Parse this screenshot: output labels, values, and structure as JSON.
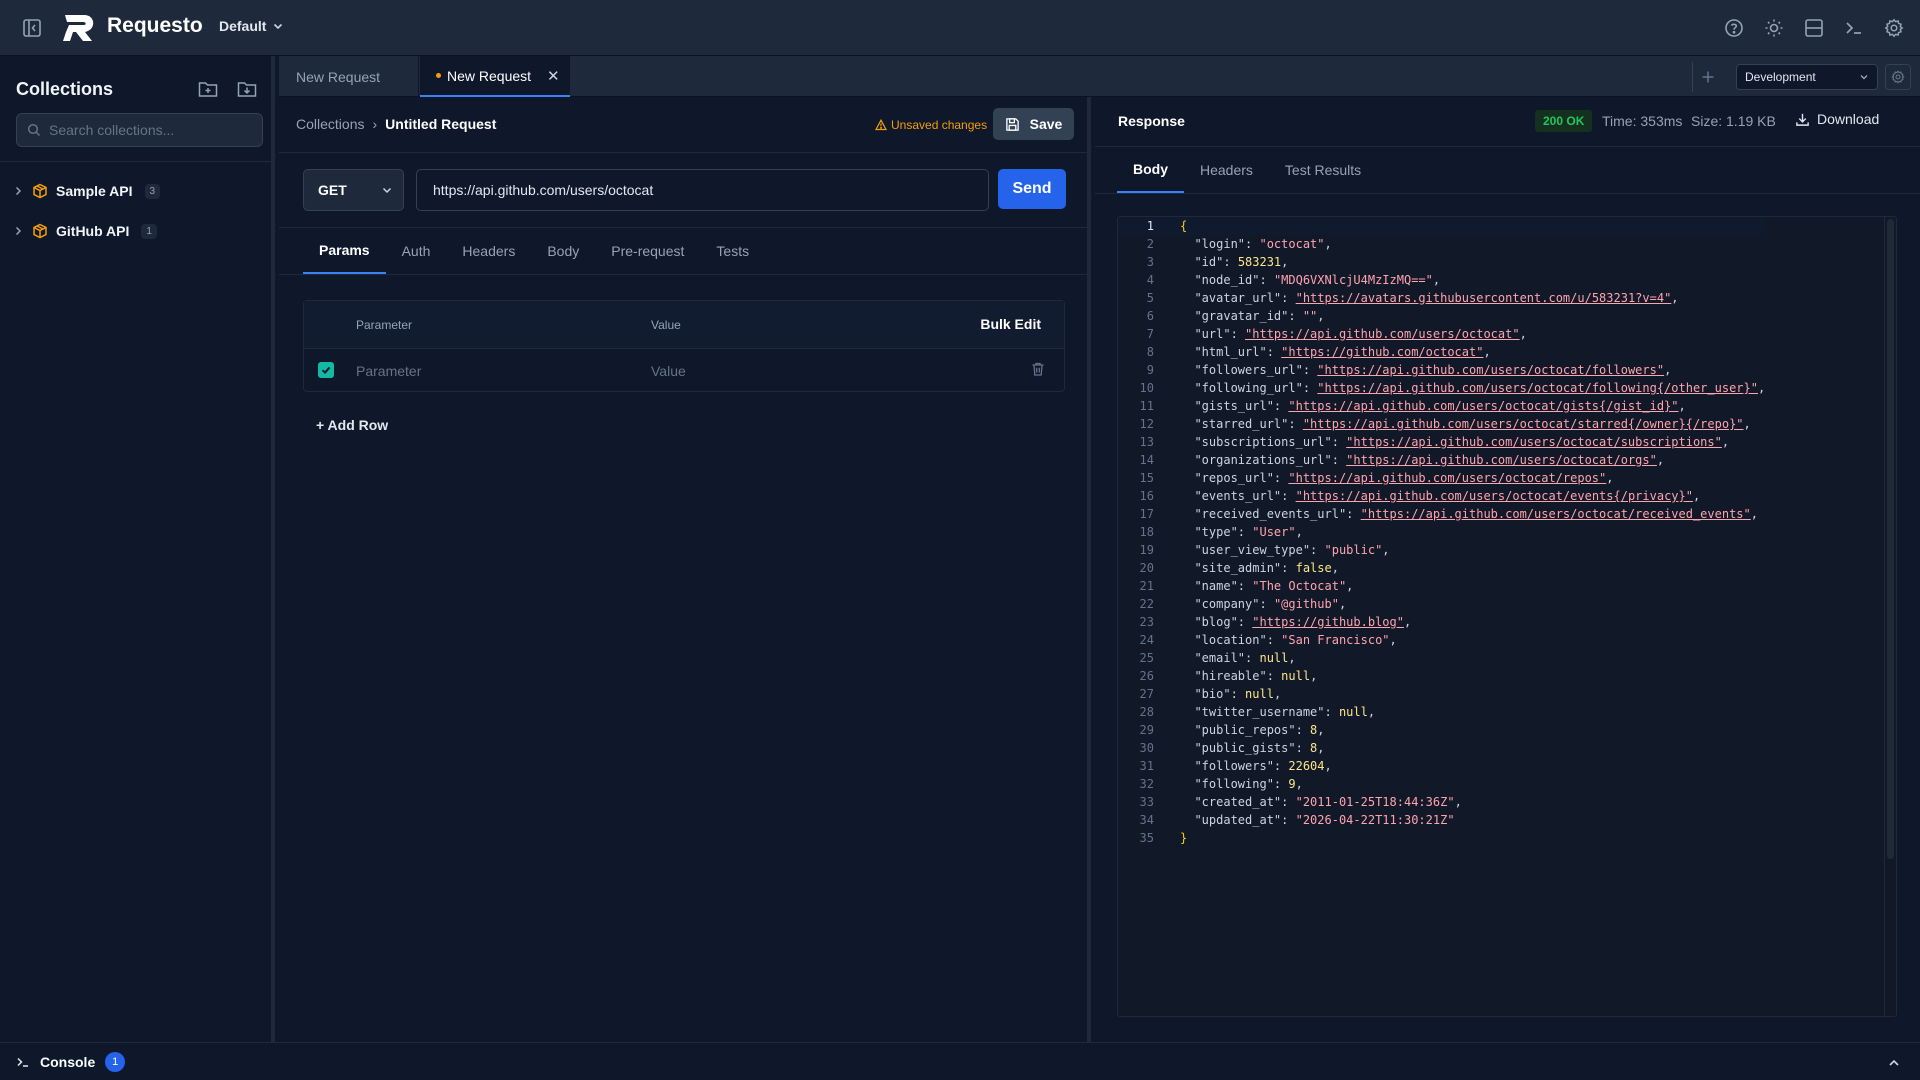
{
  "app": {
    "title": "Requesto",
    "workspace": "Default"
  },
  "sidebar": {
    "title": "Collections",
    "search_placeholder": "Search collections...",
    "collections": [
      {
        "name": "Sample API",
        "count": "3"
      },
      {
        "name": "GitHub API",
        "count": "1"
      }
    ]
  },
  "tabs": [
    {
      "label": "New Request",
      "active": false,
      "unsaved": false
    },
    {
      "label": "New Request",
      "active": true,
      "unsaved": true
    }
  ],
  "environment": {
    "selected": "Development"
  },
  "request": {
    "breadcrumb_root": "Collections",
    "breadcrumb_sep": "›",
    "title": "Untitled Request",
    "unsaved_label": "Unsaved changes",
    "save_label": "Save",
    "method": "GET",
    "url": "https://api.github.com/users/octocat",
    "send_label": "Send",
    "tabs": [
      "Params",
      "Auth",
      "Headers",
      "Body",
      "Pre-request",
      "Tests"
    ],
    "active_tab": "Params",
    "params": {
      "col_parameter": "Parameter",
      "col_value": "Value",
      "bulk_edit": "Bulk Edit",
      "row_parameter_placeholder": "Parameter",
      "row_value_placeholder": "Value",
      "row_checked": true,
      "add_row": "+ Add Row"
    }
  },
  "response": {
    "title": "Response",
    "status": "200 OK",
    "time": "Time: 353ms",
    "size": "Size: 1.19 KB",
    "download": "Download",
    "tabs": [
      "Body",
      "Headers",
      "Test Results"
    ],
    "active_tab": "Body",
    "body_lines": [
      [
        [
          "brace",
          "{"
        ]
      ],
      [
        [
          "key",
          "  \"login\""
        ],
        [
          "punct",
          ": "
        ],
        [
          "str",
          "\"octocat\""
        ],
        [
          "punct",
          ","
        ]
      ],
      [
        [
          "key",
          "  \"id\""
        ],
        [
          "punct",
          ": "
        ],
        [
          "num",
          "583231"
        ],
        [
          "punct",
          ","
        ]
      ],
      [
        [
          "key",
          "  \"node_id\""
        ],
        [
          "punct",
          ": "
        ],
        [
          "str",
          "\"MDQ6VXNlcjU4MzIzMQ==\""
        ],
        [
          "punct",
          ","
        ]
      ],
      [
        [
          "key",
          "  \"avatar_url\""
        ],
        [
          "punct",
          ": "
        ],
        [
          "url",
          "\"https://avatars.githubusercontent.com/u/583231?v=4\""
        ],
        [
          "punct",
          ","
        ]
      ],
      [
        [
          "key",
          "  \"gravatar_id\""
        ],
        [
          "punct",
          ": "
        ],
        [
          "str",
          "\"\""
        ],
        [
          "punct",
          ","
        ]
      ],
      [
        [
          "key",
          "  \"url\""
        ],
        [
          "punct",
          ": "
        ],
        [
          "url",
          "\"https://api.github.com/users/octocat\""
        ],
        [
          "punct",
          ","
        ]
      ],
      [
        [
          "key",
          "  \"html_url\""
        ],
        [
          "punct",
          ": "
        ],
        [
          "url",
          "\"https://github.com/octocat\""
        ],
        [
          "punct",
          ","
        ]
      ],
      [
        [
          "key",
          "  \"followers_url\""
        ],
        [
          "punct",
          ": "
        ],
        [
          "url",
          "\"https://api.github.com/users/octocat/followers\""
        ],
        [
          "punct",
          ","
        ]
      ],
      [
        [
          "key",
          "  \"following_url\""
        ],
        [
          "punct",
          ": "
        ],
        [
          "url",
          "\"https://api.github.com/users/octocat/following{/other_user}\""
        ],
        [
          "punct",
          ","
        ]
      ],
      [
        [
          "key",
          "  \"gists_url\""
        ],
        [
          "punct",
          ": "
        ],
        [
          "url",
          "\"https://api.github.com/users/octocat/gists{/gist_id}\""
        ],
        [
          "punct",
          ","
        ]
      ],
      [
        [
          "key",
          "  \"starred_url\""
        ],
        [
          "punct",
          ": "
        ],
        [
          "url",
          "\"https://api.github.com/users/octocat/starred{/owner}{/repo}\""
        ],
        [
          "punct",
          ","
        ]
      ],
      [
        [
          "key",
          "  \"subscriptions_url\""
        ],
        [
          "punct",
          ": "
        ],
        [
          "url",
          "\"https://api.github.com/users/octocat/subscriptions\""
        ],
        [
          "punct",
          ","
        ]
      ],
      [
        [
          "key",
          "  \"organizations_url\""
        ],
        [
          "punct",
          ": "
        ],
        [
          "url",
          "\"https://api.github.com/users/octocat/orgs\""
        ],
        [
          "punct",
          ","
        ]
      ],
      [
        [
          "key",
          "  \"repos_url\""
        ],
        [
          "punct",
          ": "
        ],
        [
          "url",
          "\"https://api.github.com/users/octocat/repos\""
        ],
        [
          "punct",
          ","
        ]
      ],
      [
        [
          "key",
          "  \"events_url\""
        ],
        [
          "punct",
          ": "
        ],
        [
          "url",
          "\"https://api.github.com/users/octocat/events{/privacy}\""
        ],
        [
          "punct",
          ","
        ]
      ],
      [
        [
          "key",
          "  \"received_events_url\""
        ],
        [
          "punct",
          ": "
        ],
        [
          "url",
          "\"https://api.github.com/users/octocat/received_events\""
        ],
        [
          "punct",
          ","
        ]
      ],
      [
        [
          "key",
          "  \"type\""
        ],
        [
          "punct",
          ": "
        ],
        [
          "str",
          "\"User\""
        ],
        [
          "punct",
          ","
        ]
      ],
      [
        [
          "key",
          "  \"user_view_type\""
        ],
        [
          "punct",
          ": "
        ],
        [
          "str",
          "\"public\""
        ],
        [
          "punct",
          ","
        ]
      ],
      [
        [
          "key",
          "  \"site_admin\""
        ],
        [
          "punct",
          ": "
        ],
        [
          "kw",
          "false"
        ],
        [
          "punct",
          ","
        ]
      ],
      [
        [
          "key",
          "  \"name\""
        ],
        [
          "punct",
          ": "
        ],
        [
          "str",
          "\"The Octocat\""
        ],
        [
          "punct",
          ","
        ]
      ],
      [
        [
          "key",
          "  \"company\""
        ],
        [
          "punct",
          ": "
        ],
        [
          "str",
          "\"@github\""
        ],
        [
          "punct",
          ","
        ]
      ],
      [
        [
          "key",
          "  \"blog\""
        ],
        [
          "punct",
          ": "
        ],
        [
          "url",
          "\"https://github.blog\""
        ],
        [
          "punct",
          ","
        ]
      ],
      [
        [
          "key",
          "  \"location\""
        ],
        [
          "punct",
          ": "
        ],
        [
          "str",
          "\"San Francisco\""
        ],
        [
          "punct",
          ","
        ]
      ],
      [
        [
          "key",
          "  \"email\""
        ],
        [
          "punct",
          ": "
        ],
        [
          "kw",
          "null"
        ],
        [
          "punct",
          ","
        ]
      ],
      [
        [
          "key",
          "  \"hireable\""
        ],
        [
          "punct",
          ": "
        ],
        [
          "kw",
          "null"
        ],
        [
          "punct",
          ","
        ]
      ],
      [
        [
          "key",
          "  \"bio\""
        ],
        [
          "punct",
          ": "
        ],
        [
          "kw",
          "null"
        ],
        [
          "punct",
          ","
        ]
      ],
      [
        [
          "key",
          "  \"twitter_username\""
        ],
        [
          "punct",
          ": "
        ],
        [
          "kw",
          "null"
        ],
        [
          "punct",
          ","
        ]
      ],
      [
        [
          "key",
          "  \"public_repos\""
        ],
        [
          "punct",
          ": "
        ],
        [
          "num",
          "8"
        ],
        [
          "punct",
          ","
        ]
      ],
      [
        [
          "key",
          "  \"public_gists\""
        ],
        [
          "punct",
          ": "
        ],
        [
          "num",
          "8"
        ],
        [
          "punct",
          ","
        ]
      ],
      [
        [
          "key",
          "  \"followers\""
        ],
        [
          "punct",
          ": "
        ],
        [
          "num",
          "22604"
        ],
        [
          "punct",
          ","
        ]
      ],
      [
        [
          "key",
          "  \"following\""
        ],
        [
          "punct",
          ": "
        ],
        [
          "num",
          "9"
        ],
        [
          "punct",
          ","
        ]
      ],
      [
        [
          "key",
          "  \"created_at\""
        ],
        [
          "punct",
          ": "
        ],
        [
          "str",
          "\"2011-01-25T18:44:36Z\""
        ],
        [
          "punct",
          ","
        ]
      ],
      [
        [
          "key",
          "  \"updated_at\""
        ],
        [
          "punct",
          ": "
        ],
        [
          "str",
          "\"2026-04-22T11:30:21Z\""
        ]
      ],
      [
        [
          "brace",
          "}"
        ]
      ]
    ]
  },
  "console": {
    "label": "Console",
    "count": "1"
  },
  "colors": {
    "accent": "#2563eb",
    "active_tab_underline": "#3b82f6",
    "warning": "#f59e0b",
    "success": "#22c55e",
    "collection_icon": "#f59e0b"
  },
  "icons": {
    "sidebar_toggle": "sidebar-toggle-icon",
    "help": "help-circle-icon",
    "theme": "sun-icon",
    "layout": "layout-icon",
    "terminal": "terminal-icon",
    "settings": "gear-icon",
    "new_folder": "folder-plus-icon",
    "import": "import-icon",
    "search": "search-icon",
    "collection": "package-icon",
    "save": "floppy-disk-icon",
    "delete": "trash-icon",
    "download": "download-icon"
  }
}
